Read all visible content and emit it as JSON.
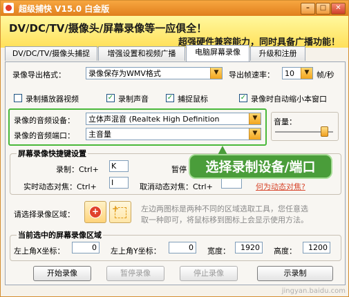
{
  "titlebar": {
    "title": "超级捕快 V15.0 白金版",
    "minimize": "–",
    "maximize": "□",
    "close": "✕"
  },
  "banner": {
    "line1": "DV/DC/TV/摄像头/屏幕录像等一应俱全！",
    "line2": "超强硬件兼容能力，同时具备广播功能！"
  },
  "tabs": [
    "DV/DC/TV/摄像头捕捉",
    "增强设置和视频广播",
    "电脑屏幕录像",
    "升级和注册"
  ],
  "export": {
    "label": "录像导出格式：",
    "value": "录像保存为WMV格式",
    "fps_label": "导出帧速率：",
    "fps_value": "10",
    "fps_unit": "帧/秒"
  },
  "options": {
    "record_player": "录制播放器视频",
    "record_sound": "录制声音",
    "capture_mouse": "捕捉鼠标",
    "auto_minimize": "录像时自动缩小本窗口"
  },
  "audio": {
    "device_label": "录像的音频设备：",
    "device_value": "立体声混音 (Realtek High Definition",
    "port_label": "录像的音频端口：",
    "port_value": "主音量",
    "volume_label": "音量："
  },
  "hotkeys": {
    "title": "屏幕录像快捷键设置",
    "record_label": "录制：Ctrl+",
    "record_key": "K",
    "pause_label": "暂停",
    "realtime_label": "实时动态对焦：Ctrl+",
    "realtime_key": "I",
    "cancel_label": "取消动态对焦：Ctrl+",
    "help_link": "何为动态对焦?"
  },
  "area": {
    "label": "请选择录像区域：",
    "desc1": "左边两图标是两种不同的区域选取工具，您任意选",
    "desc2": "取一种即可，将鼠标移到图标上会显示使用方法。"
  },
  "region": {
    "title": "当前选中的屏幕录像区域",
    "x_label": "左上角X坐标：",
    "x_value": "0",
    "y_label": "左上角Y坐标：",
    "y_value": "0",
    "w_label": "宽度：",
    "w_value": "1920",
    "h_label": "高度：",
    "h_value": "1200"
  },
  "buttons": {
    "start": "开始录像",
    "pause": "暂停录像",
    "stop": "停止录像",
    "last": "示录制"
  },
  "callout": "选择录制设备/端口",
  "watermark": "jingyan.baidu.com",
  "colors": {
    "title_orange": "#e0801c",
    "banner_yellow": "#ffe05a",
    "highlight_green": "#49b83a"
  }
}
